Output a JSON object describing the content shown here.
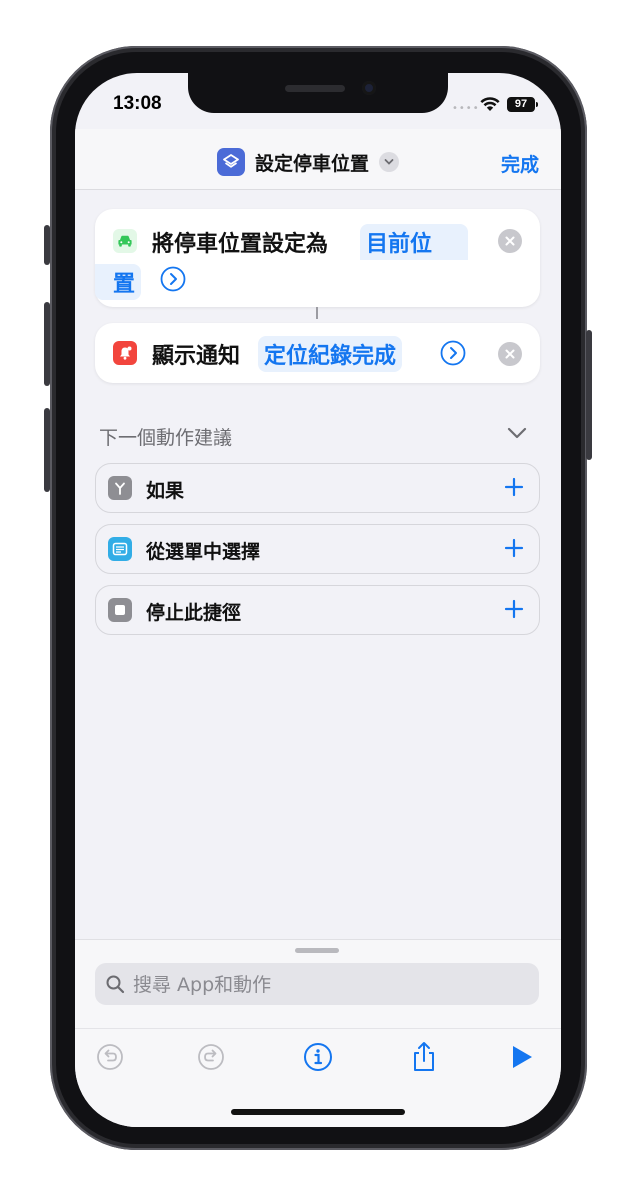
{
  "status_bar": {
    "time": "13:08",
    "battery": "97"
  },
  "nav": {
    "title": "設定停車位置",
    "done_label": "完成"
  },
  "actions": [
    {
      "text": "將停車位置設定為",
      "token_line1": "目前位",
      "token_line2": "置"
    },
    {
      "text": "顯示通知",
      "token": "定位紀錄完成"
    }
  ],
  "suggestions": {
    "title": "下一個動作建議",
    "items": [
      {
        "label": "如果"
      },
      {
        "label": "從選單中選擇"
      },
      {
        "label": "停止此捷徑"
      }
    ]
  },
  "search": {
    "placeholder": "搜尋 App和動作",
    "value": ""
  },
  "colors": {
    "accent": "#1476f0",
    "app_icon": "#4b6bd7",
    "location_icon": "#34c759",
    "notify_icon": "#f2453d",
    "menu_icon": "#32ade6",
    "gray_icon": "#8e8e93"
  }
}
